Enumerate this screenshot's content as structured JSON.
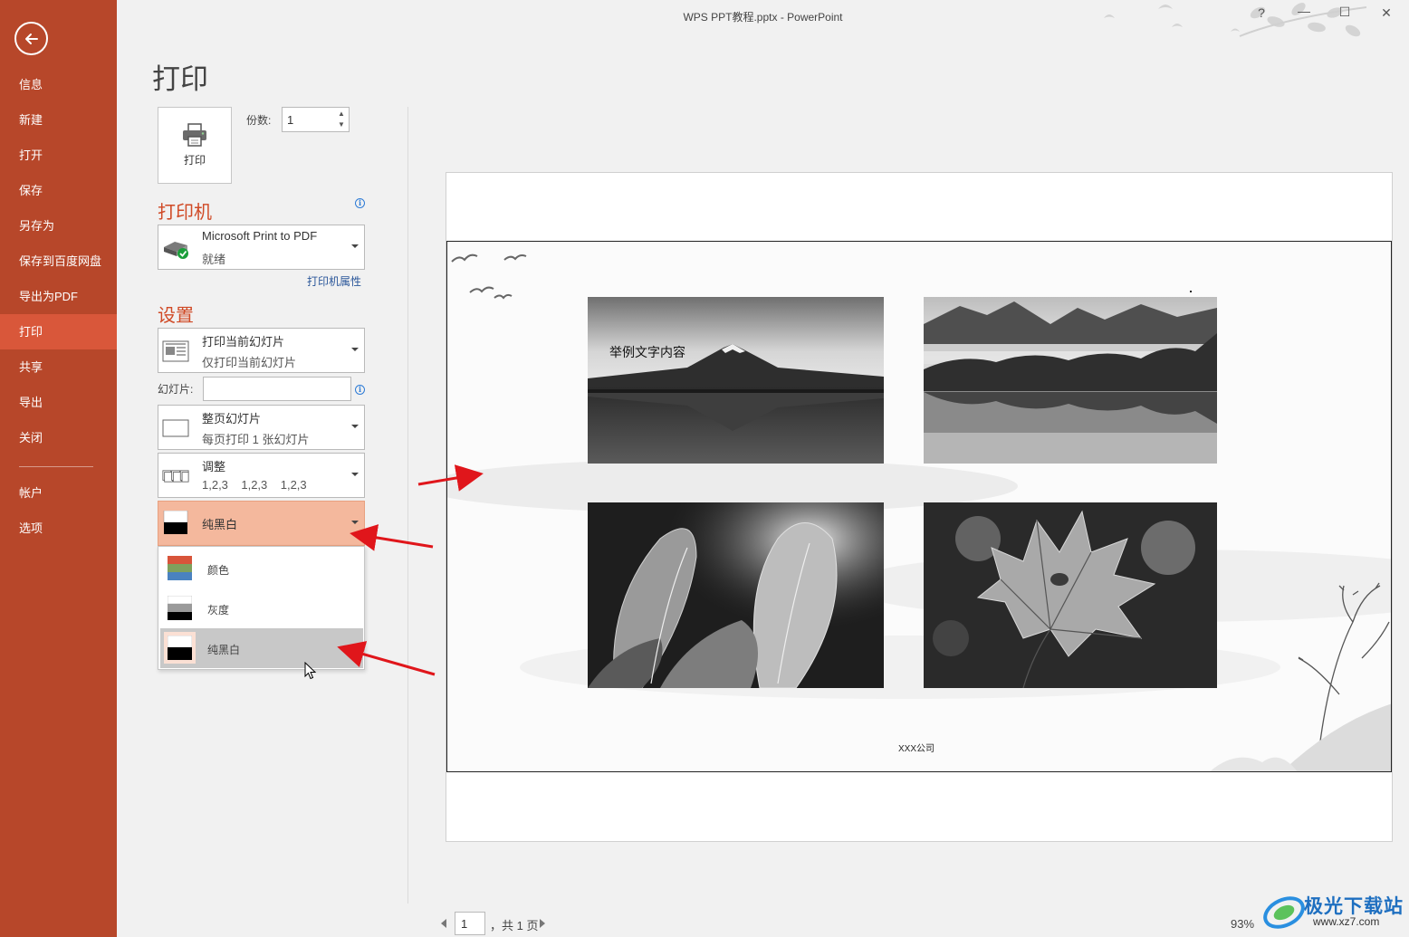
{
  "window": {
    "title": "WPS PPT教程.pptx - PowerPoint",
    "help": "?",
    "minimize": "—",
    "maximize": "☐",
    "close": "✕"
  },
  "sidebar": {
    "items": [
      {
        "label": "信息"
      },
      {
        "label": "新建"
      },
      {
        "label": "打开"
      },
      {
        "label": "保存"
      },
      {
        "label": "另存为"
      },
      {
        "label": "保存到百度网盘"
      },
      {
        "label": "导出为PDF"
      },
      {
        "label": "打印",
        "active": true
      },
      {
        "label": "共享"
      },
      {
        "label": "导出"
      },
      {
        "label": "关闭"
      }
    ],
    "bottom_items": [
      {
        "label": "帐户"
      },
      {
        "label": "选项"
      }
    ]
  },
  "page": {
    "title": "打印"
  },
  "print": {
    "button_label": "打印",
    "copies_label": "份数:",
    "copies_value": "1"
  },
  "printer": {
    "section_title": "打印机",
    "name": "Microsoft Print to PDF",
    "status": "就绪",
    "properties_link": "打印机属性"
  },
  "settings": {
    "section_title": "设置",
    "range": {
      "title": "打印当前幻灯片",
      "subtitle": "仅打印当前幻灯片"
    },
    "slides_label": "幻灯片:",
    "slides_value": "",
    "layout": {
      "title": "整页幻灯片",
      "subtitle": "每页打印 1 张幻灯片"
    },
    "collate": {
      "title": "调整",
      "subtitle": "1,2,3    1,2,3    1,2,3"
    },
    "color": {
      "title": "纯黑白"
    },
    "color_options": [
      {
        "label": "颜色"
      },
      {
        "label": "灰度"
      },
      {
        "label": "纯黑白",
        "selected": true
      }
    ]
  },
  "preview": {
    "slide_text": "举例文字内容",
    "footer_text": "XXX公司"
  },
  "pager": {
    "current_page": "1",
    "total_text": "，共 1 页"
  },
  "zoom": {
    "level": "93%"
  },
  "watermark": {
    "text": "极光下载站",
    "url": "www.xz7.com"
  },
  "colors": {
    "sidebar": "#b7472a",
    "sidebar_active": "#d9573a",
    "section_title": "#d04a26",
    "dropdown_highlight": "#f4b89d",
    "link": "#2b579a",
    "annotation_arrow": "#e0161b"
  }
}
